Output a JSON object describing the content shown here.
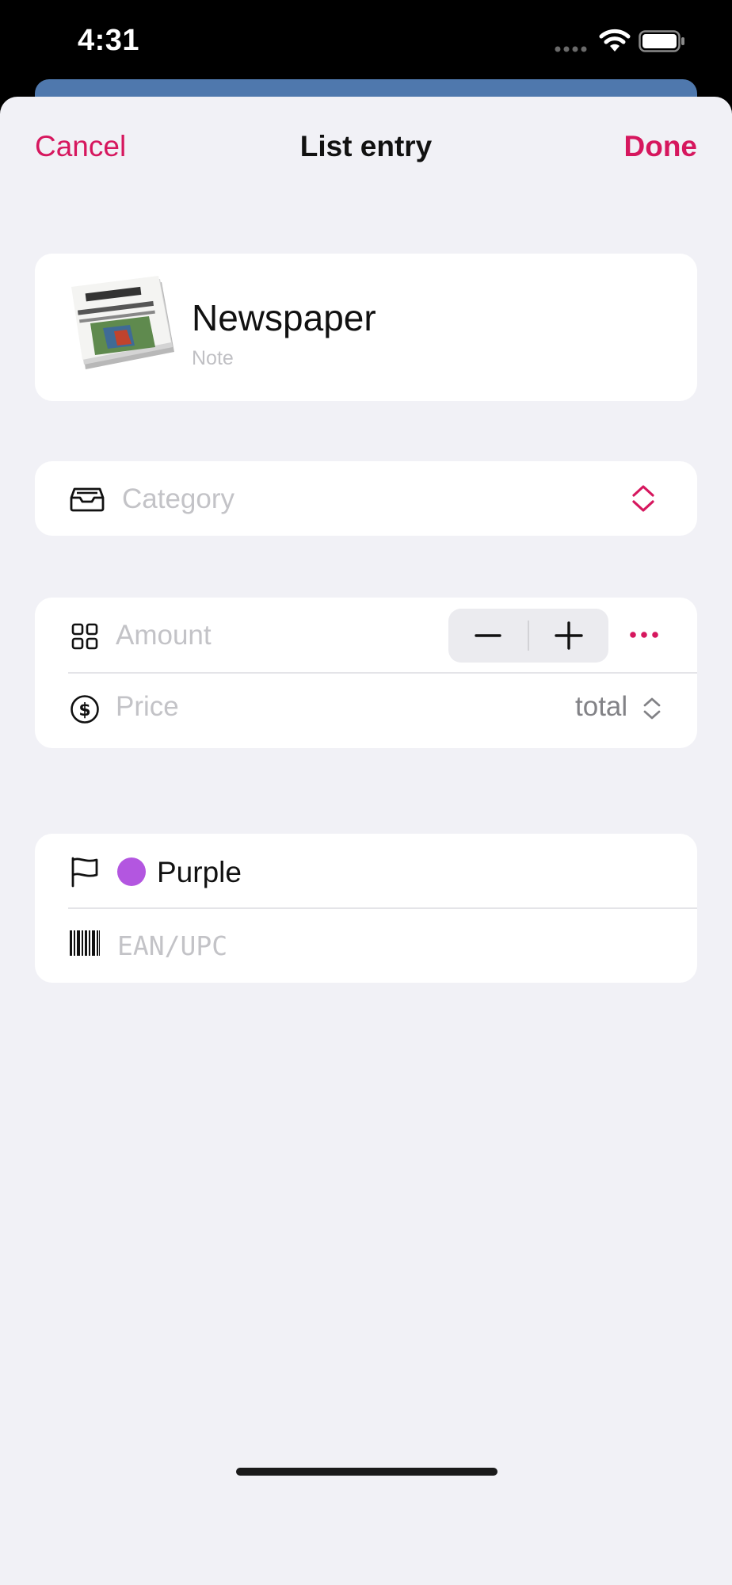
{
  "status_bar": {
    "time": "4:31"
  },
  "nav": {
    "cancel_label": "Cancel",
    "title": "List entry",
    "done_label": "Done"
  },
  "item": {
    "name": "Newspaper",
    "note_placeholder": "Note",
    "thumbnail": "newspaper-image"
  },
  "category": {
    "placeholder": "Category",
    "icon": "tray-icon"
  },
  "amount": {
    "placeholder": "Amount",
    "icon": "grid-icon"
  },
  "price": {
    "placeholder": "Price",
    "icon": "dollar-circle-icon",
    "mode": "total"
  },
  "tag": {
    "color_name": "Purple",
    "color": "#b356e0",
    "icon": "flag-icon"
  },
  "barcode": {
    "placeholder": "EAN/UPC",
    "icon": "barcode-icon"
  },
  "colors": {
    "accent": "#d6175e",
    "background": "#f1f1f6",
    "card": "#ffffff"
  }
}
